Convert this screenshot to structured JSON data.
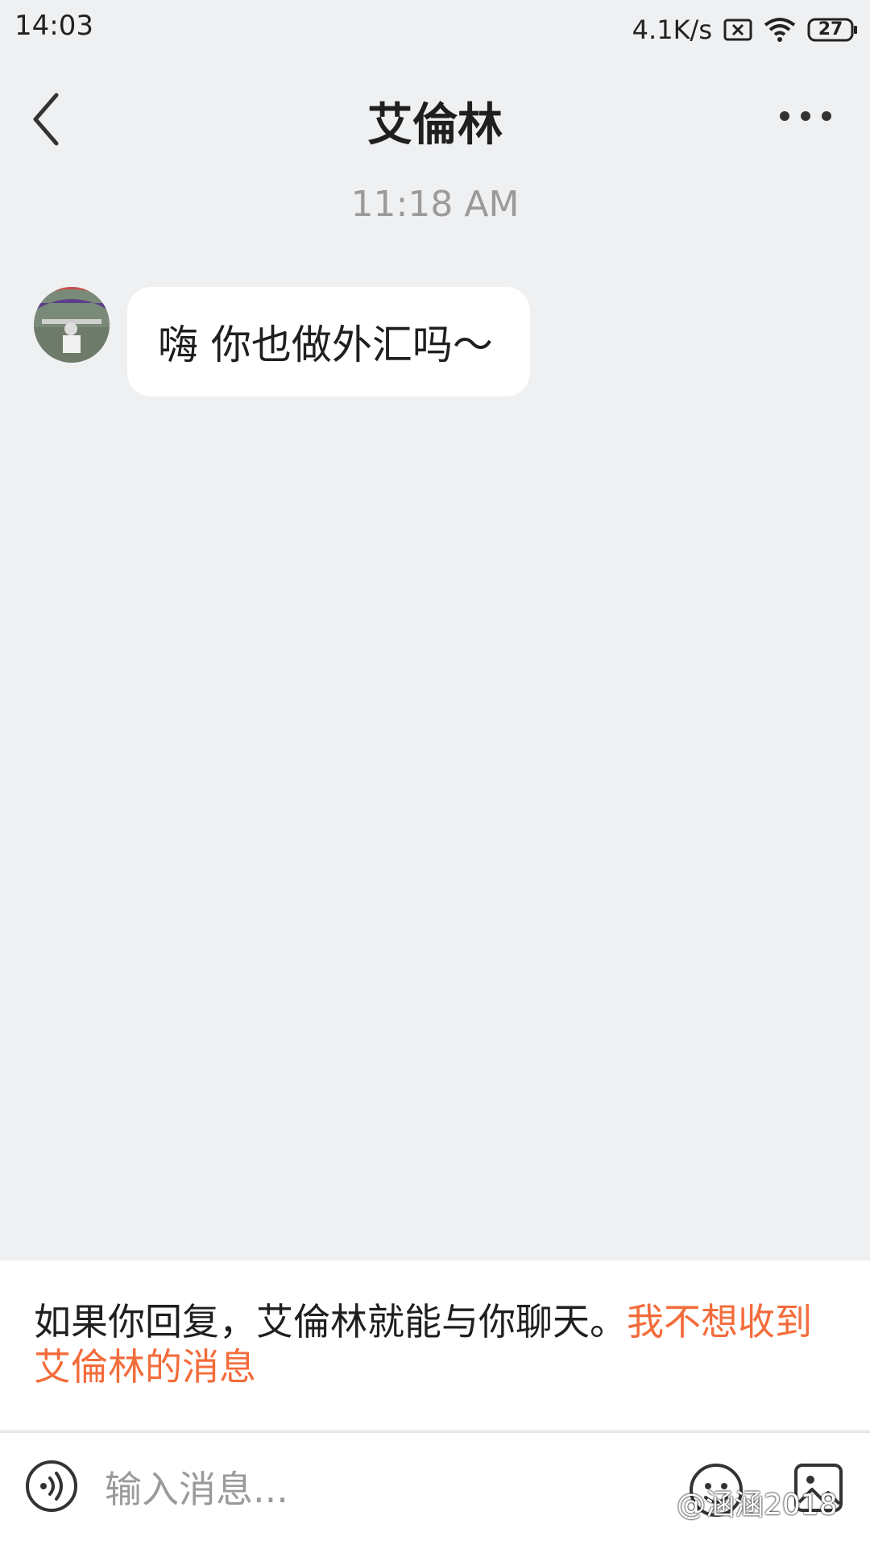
{
  "status_bar": {
    "time": "14:03",
    "network_speed": "4.1K/s",
    "battery": "27"
  },
  "header": {
    "title": "艾倫林",
    "back_icon": "chevron-left-icon",
    "more_icon": "more-horizontal-icon"
  },
  "chat": {
    "timestamp": "11:18 AM",
    "messages": [
      {
        "sender": "艾倫林",
        "text": "嗨 你也做外汇吗～",
        "direction": "incoming"
      }
    ]
  },
  "notice": {
    "text": "如果你回复，艾倫林就能与你聊天。",
    "link": "我不想收到艾倫林的消息",
    "link_color": "#f36c3b"
  },
  "input_bar": {
    "placeholder": "输入消息...",
    "voice_icon": "voice-icon",
    "emoji_icon": "emoji-icon",
    "image_icon": "image-icon"
  },
  "watermark": "@涵涵2018"
}
